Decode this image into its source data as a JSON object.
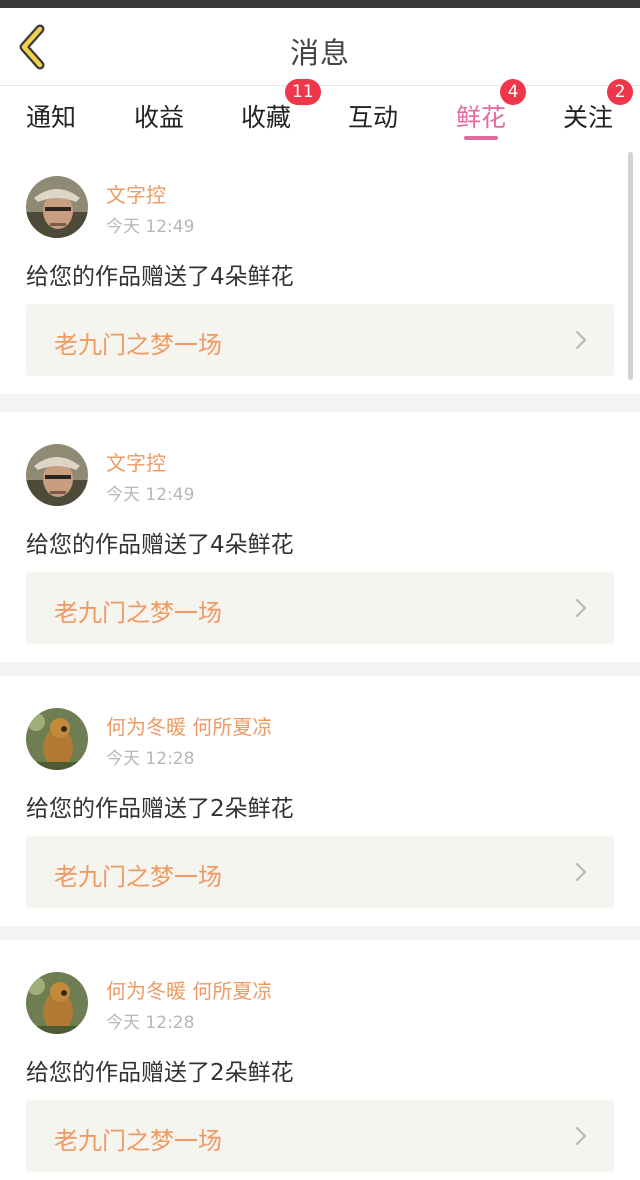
{
  "header": {
    "title": "消息",
    "back_icon": "chevron-left-icon"
  },
  "tabs": [
    {
      "label": "通知",
      "badge": ""
    },
    {
      "label": "收益",
      "badge": ""
    },
    {
      "label": "收藏",
      "badge": "11"
    },
    {
      "label": "互动",
      "badge": ""
    },
    {
      "label": "鲜花",
      "badge": "4",
      "active": true
    },
    {
      "label": "关注",
      "badge": "2"
    }
  ],
  "colors": {
    "accent": "#e46aa0",
    "name_orange": "#ee9a64",
    "badge_red": "#f0364a"
  },
  "messages": [
    {
      "user": "文字控",
      "time": "今天 12:49",
      "text": "给您的作品赠送了4朵鲜花",
      "work": "老九门之梦一场",
      "avatar": "man-hat-avatar"
    },
    {
      "user": "文字控",
      "time": "今天 12:49",
      "text": "给您的作品赠送了4朵鲜花",
      "work": "老九门之梦一场",
      "avatar": "man-hat-avatar"
    },
    {
      "user": "何为冬暖 何所夏凉",
      "time": "今天 12:28",
      "text": "给您的作品赠送了2朵鲜花",
      "work": "老九门之梦一场",
      "avatar": "monkey-avatar"
    },
    {
      "user": "何为冬暖 何所夏凉",
      "time": "今天 12:28",
      "text": "给您的作品赠送了2朵鲜花",
      "work": "老九门之梦一场",
      "avatar": "monkey-avatar"
    }
  ]
}
